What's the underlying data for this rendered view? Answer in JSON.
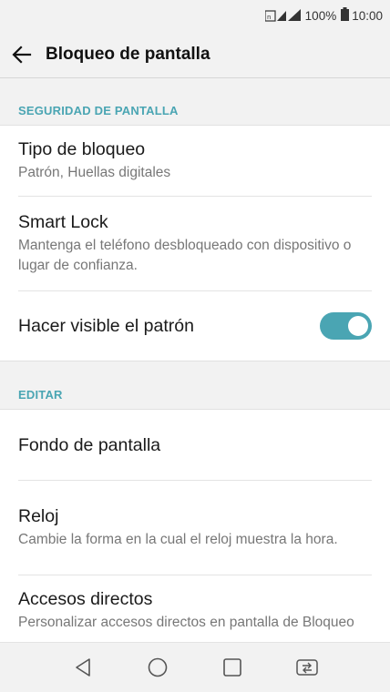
{
  "status_bar": {
    "battery": "100%",
    "time": "10:00"
  },
  "app_bar": {
    "title": "Bloqueo de pantalla"
  },
  "sections": {
    "security": {
      "header": "SEGURIDAD DE PANTALLA",
      "lock_type": {
        "title": "Tipo de bloqueo",
        "subtitle": "Patrón, Huellas digitales"
      },
      "smart_lock": {
        "title": "Smart Lock",
        "subtitle": "Mantenga el teléfono desbloqueado con dispositivo o lugar de confianza."
      },
      "visible_pattern": {
        "title": "Hacer visible el patrón",
        "enabled": true
      }
    },
    "edit": {
      "header": "EDITAR",
      "wallpaper": {
        "title": "Fondo de pantalla"
      },
      "clock": {
        "title": "Reloj",
        "subtitle": "Cambie la forma en la cual el reloj muestra la hora."
      },
      "shortcuts": {
        "title": "Accesos directos",
        "subtitle": "Personalizar accesos directos en pantalla de Bloqueo"
      }
    }
  },
  "colors": {
    "accent": "#4aa5b3",
    "background": "#f2f2f2"
  }
}
